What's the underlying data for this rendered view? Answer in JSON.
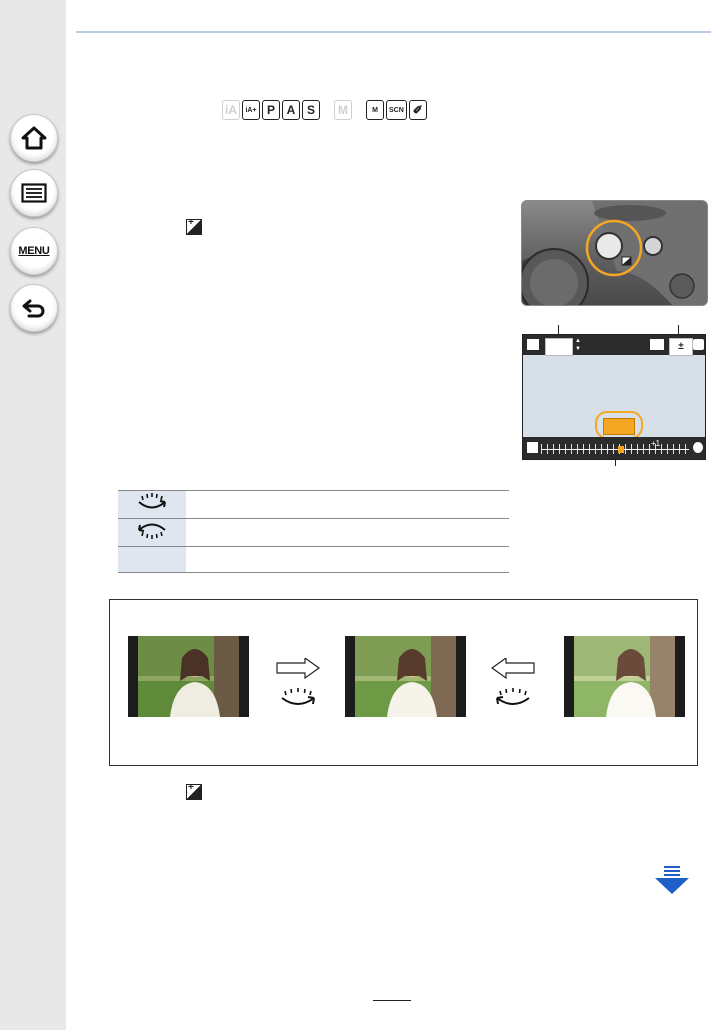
{
  "nav": {
    "home_icon": "home-icon",
    "list_icon": "list-icon",
    "menu_label": "MENU",
    "back_icon": "back-icon"
  },
  "modes": [
    {
      "label": "iA",
      "dim": true
    },
    {
      "label": "iA+",
      "dim": false
    },
    {
      "label": "P",
      "dim": false
    },
    {
      "label": "A",
      "dim": false
    },
    {
      "label": "S",
      "dim": false
    },
    {
      "label": "M",
      "dim": true
    },
    {
      "label": "M",
      "dim": false
    },
    {
      "label": "SCN",
      "dim": false
    },
    {
      "label": "✐",
      "dim": false
    }
  ],
  "monitor": {
    "flash_value": "±",
    "scale_mark": "+1"
  },
  "colors": {
    "accent_orange": "#f5a623",
    "header_rule": "#b9cde6",
    "table_icon_bg": "#dfe6f0",
    "next_arrow": "#1f5fc6"
  },
  "page_number": ""
}
